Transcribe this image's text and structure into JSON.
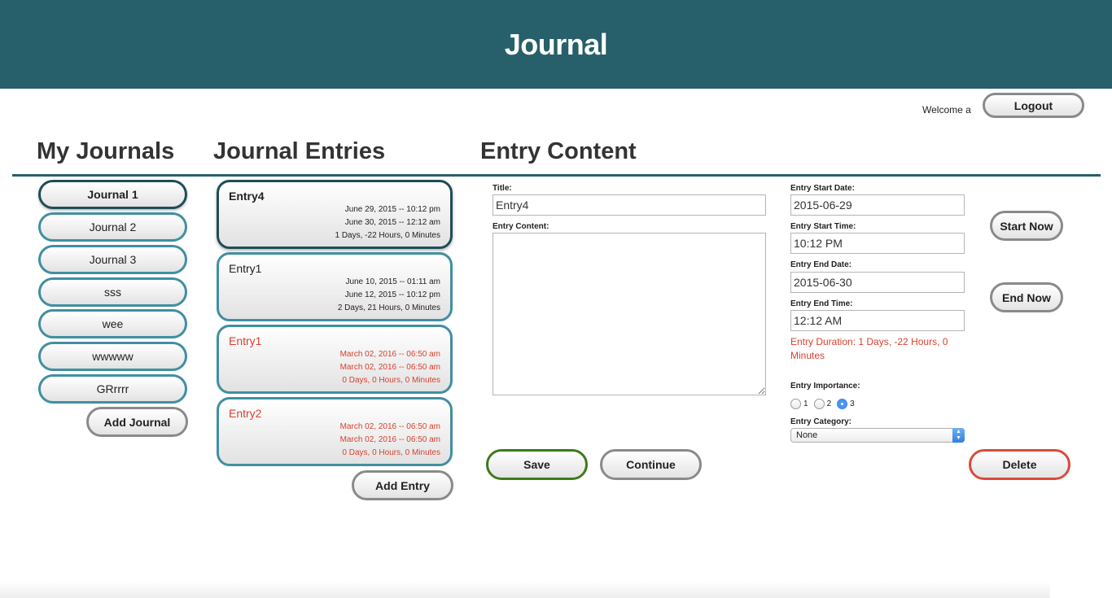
{
  "app": {
    "title": "Journal"
  },
  "user": {
    "welcome": "Welcome a",
    "logout_label": "Logout"
  },
  "journals": {
    "heading": "My Journals",
    "items": [
      {
        "label": "Journal 1",
        "active": true
      },
      {
        "label": "Journal 2"
      },
      {
        "label": "Journal 3"
      },
      {
        "label": "sss"
      },
      {
        "label": "wee"
      },
      {
        "label": "wwwww"
      },
      {
        "label": "GRrrrr"
      }
    ],
    "add_label": "Add Journal"
  },
  "entries": {
    "heading": "Journal Entries",
    "items": [
      {
        "title": "Entry4",
        "start": "June 29, 2015 -- 10:12 pm",
        "end": "June 30, 2015 -- 12:12 am",
        "duration": "1 Days, -22 Hours, 0 Minutes",
        "active": true
      },
      {
        "title": "Entry1",
        "start": "June 10, 2015 -- 01:11 am",
        "end": "June 12, 2015 -- 10:12 pm",
        "duration": "2 Days, 21 Hours, 0 Minutes"
      },
      {
        "title": "Entry1",
        "start": "March 02, 2016 -- 06:50 am",
        "end": "March 02, 2016 -- 06:50 am",
        "duration": "0 Days, 0 Hours, 0 Minutes",
        "highlight": "red"
      },
      {
        "title": "Entry2",
        "start": "March 02, 2016 -- 06:50 am",
        "end": "March 02, 2016 -- 06:50 am",
        "duration": "0 Days, 0 Hours, 0 Minutes",
        "highlight": "red"
      }
    ],
    "add_label": "Add Entry"
  },
  "content": {
    "heading": "Entry Content",
    "title_label": "Title:",
    "title_value": "Entry4",
    "content_label": "Entry Content:",
    "content_value": "",
    "start_date_label": "Entry Start Date:",
    "start_date_value": "2015-06-29",
    "start_time_label": "Entry Start Time:",
    "start_time_value": "10:12 PM",
    "end_date_label": "Entry End Date:",
    "end_date_value": "2015-06-30",
    "end_time_label": "Entry End Time:",
    "end_time_value": "12:12 AM",
    "duration_text": "Entry Duration: 1 Days, -22 Hours, 0 Minutes",
    "importance_label": "Entry Importance:",
    "importance_options": [
      "1",
      "2",
      "3"
    ],
    "importance_selected": "3",
    "category_label": "Entry Category:",
    "category_value": "None",
    "start_now_label": "Start Now",
    "end_now_label": "End Now",
    "save_label": "Save",
    "continue_label": "Continue",
    "delete_label": "Delete"
  },
  "colors": {
    "header": "#275f6a",
    "item_border": "#418fa0",
    "active_border": "#1f4d57",
    "alert": "#d9402e",
    "save_border": "#3e7a1a",
    "delete_border": "#d94a3a"
  }
}
